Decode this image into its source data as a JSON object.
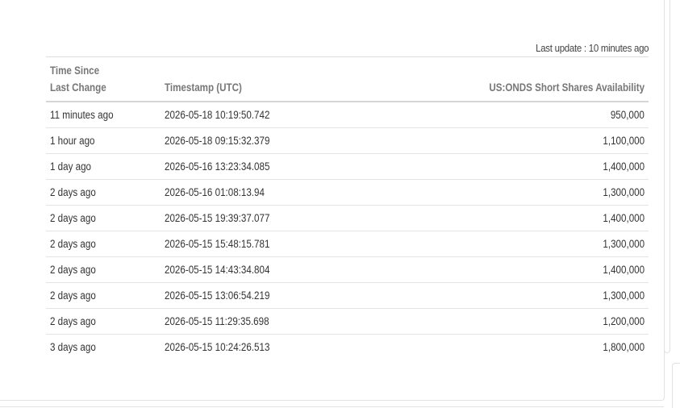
{
  "status": {
    "last_update": "Last update : 10 minutes ago"
  },
  "table": {
    "headers": {
      "time_since_line1": "Time Since",
      "time_since_line2": "Last Change",
      "timestamp": "Timestamp (UTC)",
      "availability": "US:ONDS Short Shares Availability"
    },
    "rows": [
      {
        "since": "11 minutes ago",
        "timestamp": "2026-05-18 10:19:50.742",
        "value": "950,000"
      },
      {
        "since": "1 hour ago",
        "timestamp": "2026-05-18 09:15:32.379",
        "value": "1,100,000"
      },
      {
        "since": "1 day ago",
        "timestamp": "2026-05-16 13:23:34.085",
        "value": "1,400,000"
      },
      {
        "since": "2 days ago",
        "timestamp": "2026-05-16 01:08:13.94",
        "value": "1,300,000"
      },
      {
        "since": "2 days ago",
        "timestamp": "2026-05-15 19:39:37.077",
        "value": "1,400,000"
      },
      {
        "since": "2 days ago",
        "timestamp": "2026-05-15 15:48:15.781",
        "value": "1,300,000"
      },
      {
        "since": "2 days ago",
        "timestamp": "2026-05-15 14:43:34.804",
        "value": "1,400,000"
      },
      {
        "since": "2 days ago",
        "timestamp": "2026-05-15 13:06:54.219",
        "value": "1,300,000"
      },
      {
        "since": "2 days ago",
        "timestamp": "2026-05-15 11:29:35.698",
        "value": "1,200,000"
      },
      {
        "since": "3 days ago",
        "timestamp": "2026-05-15 10:24:26.513",
        "value": "1,800,000"
      }
    ]
  }
}
